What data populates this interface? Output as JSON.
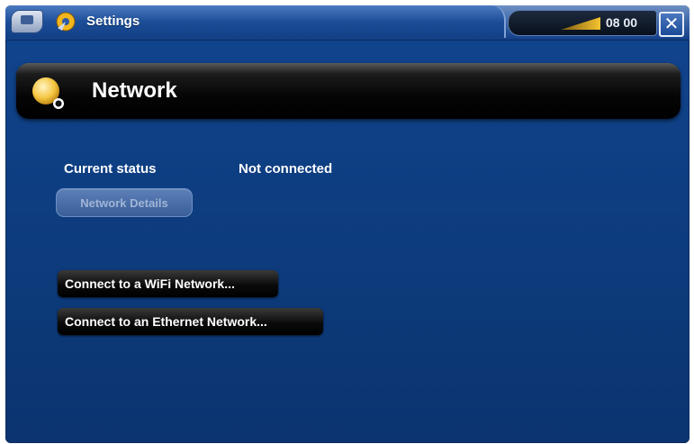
{
  "topbar": {
    "app_title": "Settings",
    "time": "08 00",
    "close_symbol": "✕",
    "icons": {
      "home": "home-icon",
      "settings": "settings-icon",
      "signal": "signal-strength-icon",
      "close": "close-icon"
    }
  },
  "header": {
    "title": "Network",
    "icon": "network-icon"
  },
  "status": {
    "label": "Current status",
    "value": "Not connected"
  },
  "buttons": {
    "network_details": "Network Details",
    "connect_wifi": "Connect to a WiFi Network...",
    "connect_ethernet": "Connect to an Ethernet Network..."
  },
  "colors": {
    "background_blue": "#0f3f86",
    "header_black": "#000000",
    "text_white": "#ffffff",
    "disabled_button": "#5c7fb8"
  }
}
